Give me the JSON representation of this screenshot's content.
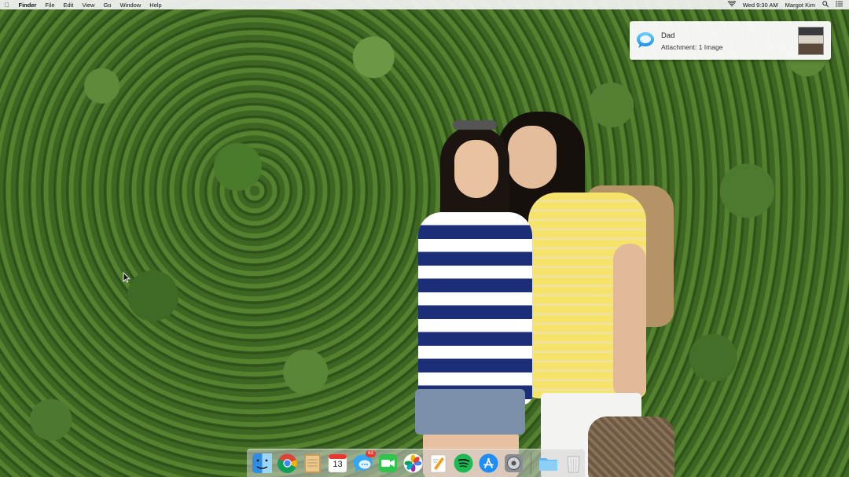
{
  "menubar": {
    "app_name": "Finder",
    "menus": [
      "File",
      "Edit",
      "View",
      "Go",
      "Window",
      "Help"
    ],
    "clock": "Wed 9:30 AM",
    "user": "Margot Kim",
    "icons": [
      "wifi-icon",
      "search-icon",
      "notification-center-icon"
    ]
  },
  "notification": {
    "app_icon": "messages-icon",
    "title": "Dad",
    "body": "Attachment: 1 Image"
  },
  "dock": {
    "apps": [
      {
        "name": "finder-icon"
      },
      {
        "name": "chrome-icon"
      },
      {
        "name": "notes-icon"
      },
      {
        "name": "calendar-icon",
        "date": "13"
      },
      {
        "name": "messages-icon",
        "badge": "63"
      },
      {
        "name": "facetime-icon"
      },
      {
        "name": "photos-icon"
      },
      {
        "name": "pages-icon"
      },
      {
        "name": "spotify-icon"
      },
      {
        "name": "app-store-icon"
      },
      {
        "name": "system-preferences-icon"
      },
      {
        "name": "downloads-folder-icon"
      },
      {
        "name": "trash-icon"
      }
    ]
  },
  "colors": {
    "menubar_bg": "#f5f5f5",
    "badge_red": "#e8392e",
    "messages_blue": "#35a7f2"
  }
}
